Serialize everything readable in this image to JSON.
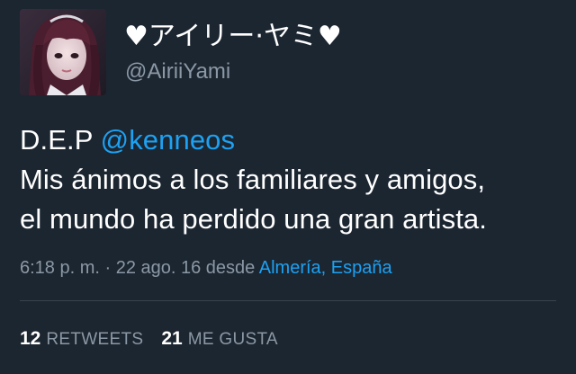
{
  "user": {
    "display_name": "♥アイリー·ヤミ♥",
    "handle": "@AiriiYami",
    "avatar_icon": "profile-photo"
  },
  "tweet": {
    "prefix": "D.E.P ",
    "mention": "@kenneos",
    "line2": "Mis ánimos a los familiares y amigos,",
    "line3": "el mundo ha perdido una gran artista."
  },
  "meta": {
    "time": "6:18 p. m.",
    "separator": " · ",
    "date": "22 ago. 16",
    "from_label": " desde ",
    "location": "Almería, España"
  },
  "stats": {
    "retweets_count": "12",
    "retweets_label": "RETWEETS",
    "likes_count": "21",
    "likes_label": "ME GUSTA"
  },
  "colors": {
    "background": "#1c2631",
    "link": "#1da1f2",
    "secondary_text": "#8b98a5"
  }
}
